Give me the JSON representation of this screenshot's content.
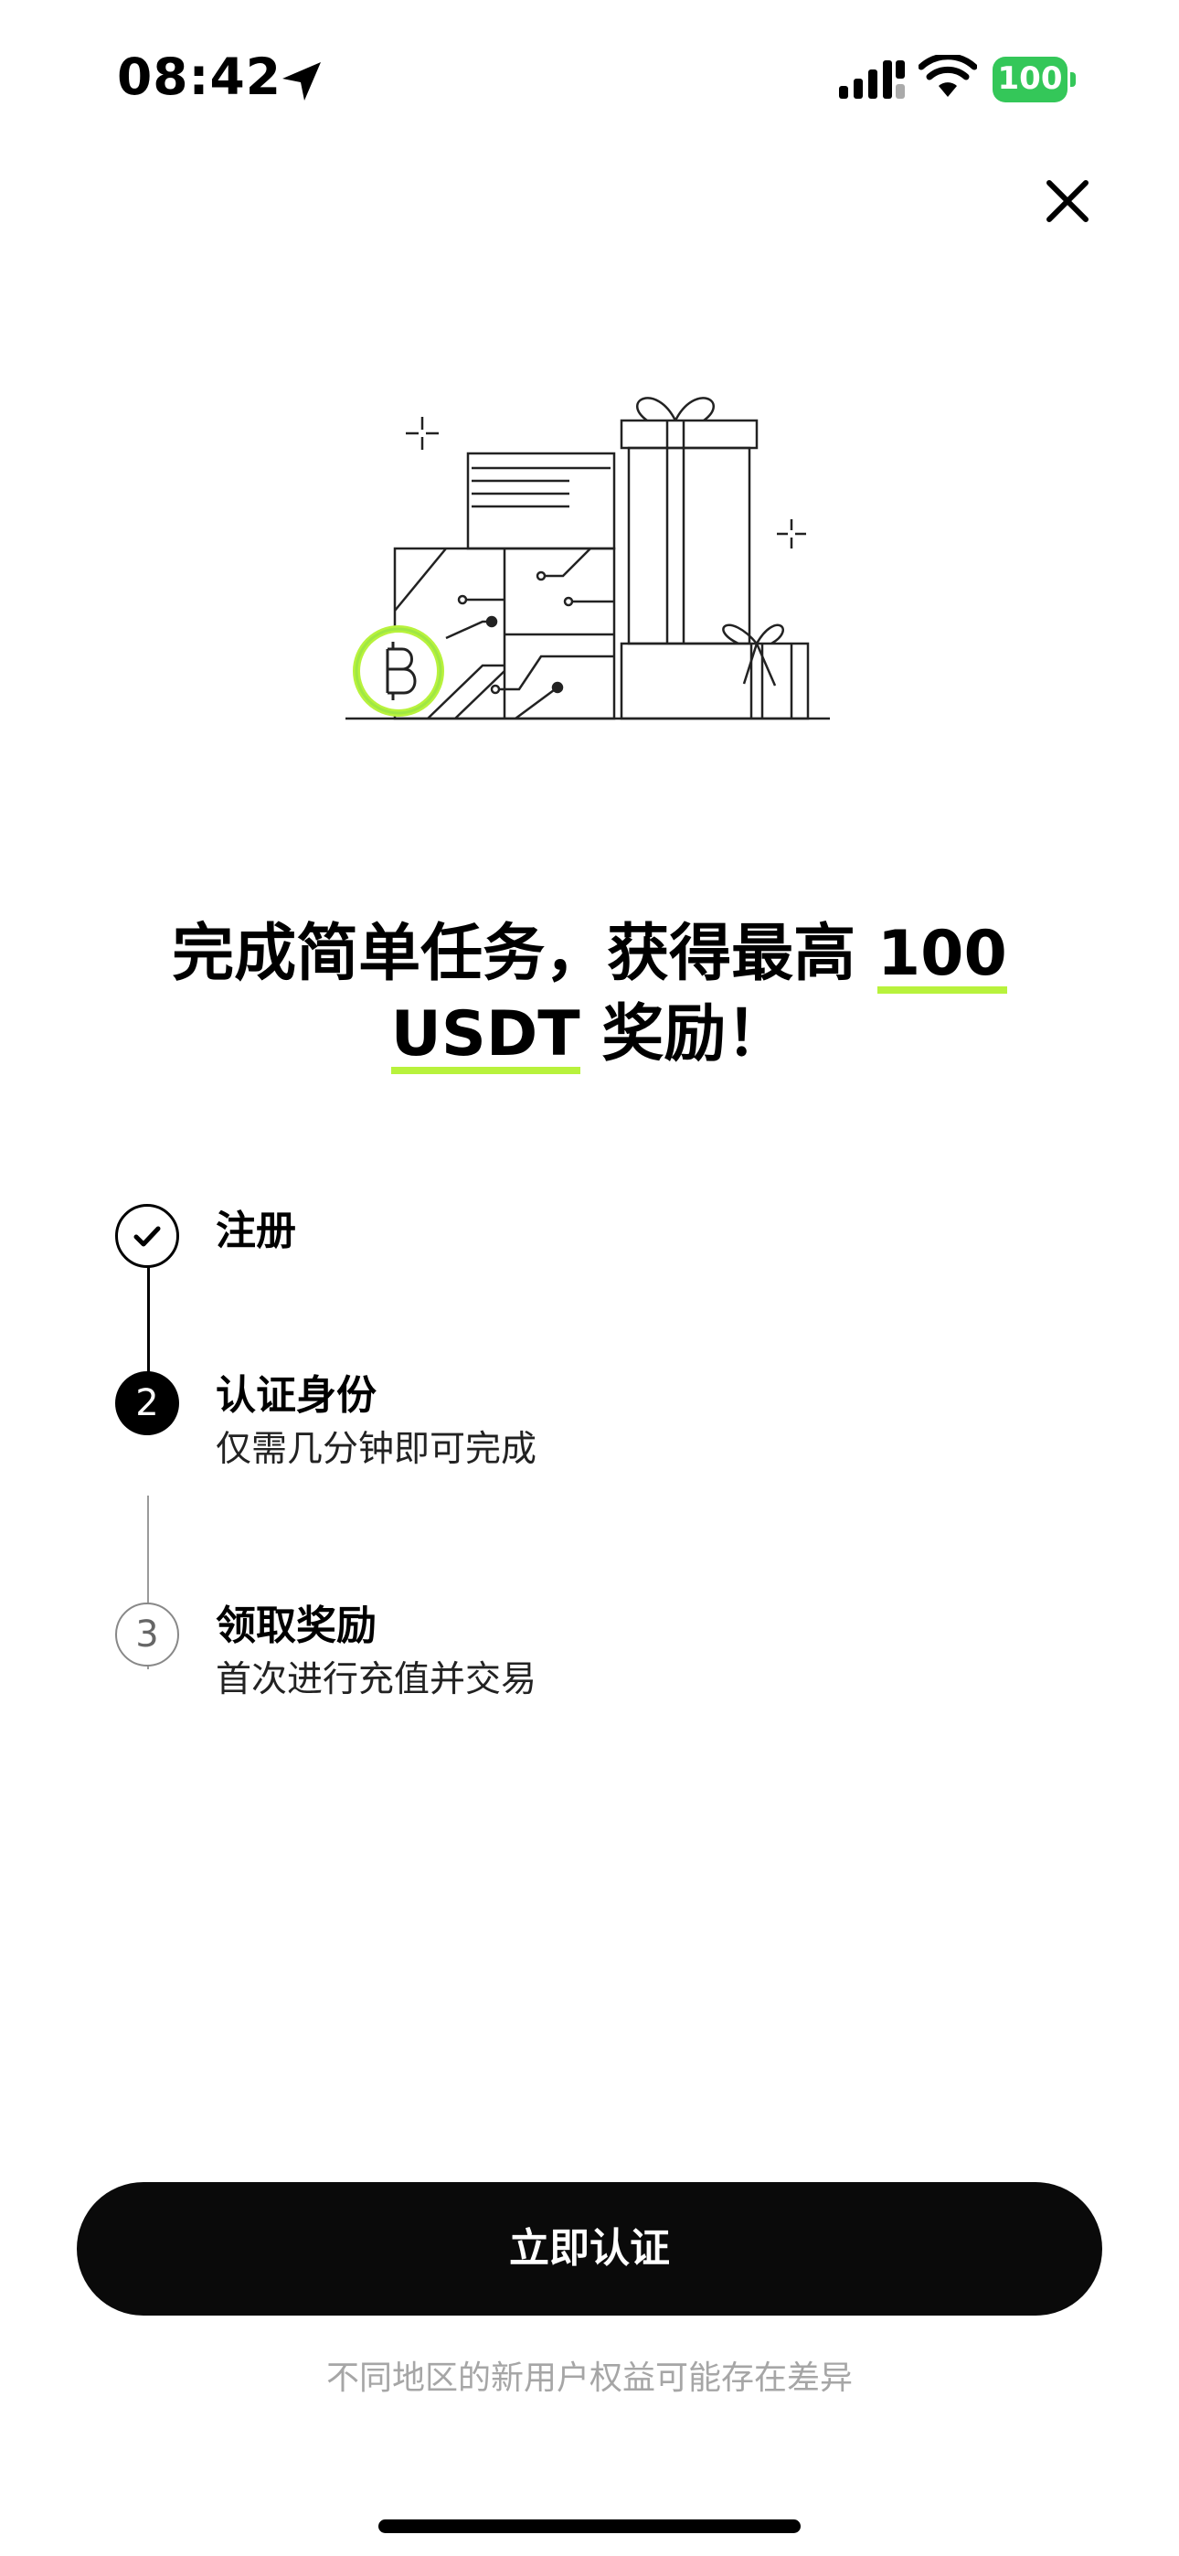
{
  "status_bar": {
    "time": "08:42",
    "battery": "100",
    "icons": [
      "location-arrow-icon",
      "signal-icon",
      "wifi-icon",
      "battery-icon"
    ]
  },
  "close_icon": "close-icon",
  "headline": {
    "part1": "完成简单任务，获得最高 ",
    "highlight1": "100",
    "highlight2": "USDT",
    "part2": " 奖励！"
  },
  "steps": [
    {
      "title": "注册",
      "subtitle": "",
      "state": "done",
      "marker": "checkmark-icon"
    },
    {
      "title": "认证身份",
      "subtitle": "仅需几分钟即可完成",
      "state": "active",
      "marker": "2"
    },
    {
      "title": "领取奖励",
      "subtitle": "首次进行充值并交易",
      "state": "pending",
      "marker": "3"
    }
  ],
  "cta": {
    "label": "立即认证"
  },
  "disclaimer": "不同地区的新用户权益可能存在差异",
  "colors": {
    "accent": "#b8f23c",
    "battery": "#34c759",
    "button": "#0a0a0a"
  }
}
